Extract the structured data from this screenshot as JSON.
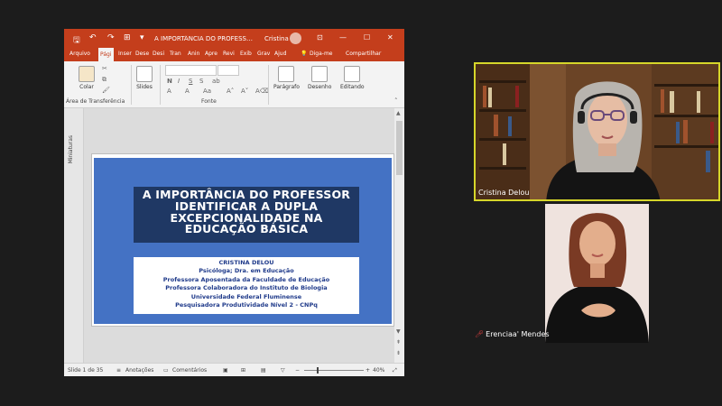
{
  "window": {
    "doc_title": "A IMPORTÂNCIA DO PROFESSOR...",
    "user_name": "Cristina"
  },
  "ribbon_tabs": [
    "Arquivo",
    "Pági",
    "Inser",
    "Dese",
    "Desi",
    "Tran",
    "Anin",
    "Apre",
    "Revi",
    "Exib",
    "Grav",
    "Ajud",
    "Diga-me",
    "Compartilhar"
  ],
  "ribbon": {
    "paste_label": "Colar",
    "clipboard_group": "Área de Transferência",
    "slides_label": "Slides",
    "font_group": "Fonte",
    "paragraph_label": "Parágrafo",
    "drawing_label": "Desenho",
    "editing_label": "Editando"
  },
  "thumbs_label": "Miniaturas",
  "slide": {
    "title": "A IMPORTÂNCIA DO PROFESSOR IDENTIFICAR A DUPLA EXCEPCIONALIDADE NA EDUCAÇÃO BÁSICA",
    "info": [
      "CRISTINA DELOU",
      "Psicóloga; Dra. em Educação",
      "Professora Aposentada da Faculdade de Educação",
      "Professora Colaboradora  do Instituto de Biologia",
      "Universidade Federal Fluminense",
      "Pesquisadora Produtividade Nível 2 - CNPq"
    ]
  },
  "status": {
    "slide_counter": "Slide 1 de 35",
    "accessibility": "Anotações",
    "comments": "Comentários",
    "zoom": "40%"
  },
  "participants": [
    {
      "name": "Cristina Delou"
    },
    {
      "name": "Erenciaa' Mendes"
    }
  ],
  "colors": {
    "ppt_accent": "#c43e1c",
    "slide_bg": "#4472c4",
    "title_box": "#1f3864",
    "active_speaker_border": "#d6d62a"
  }
}
